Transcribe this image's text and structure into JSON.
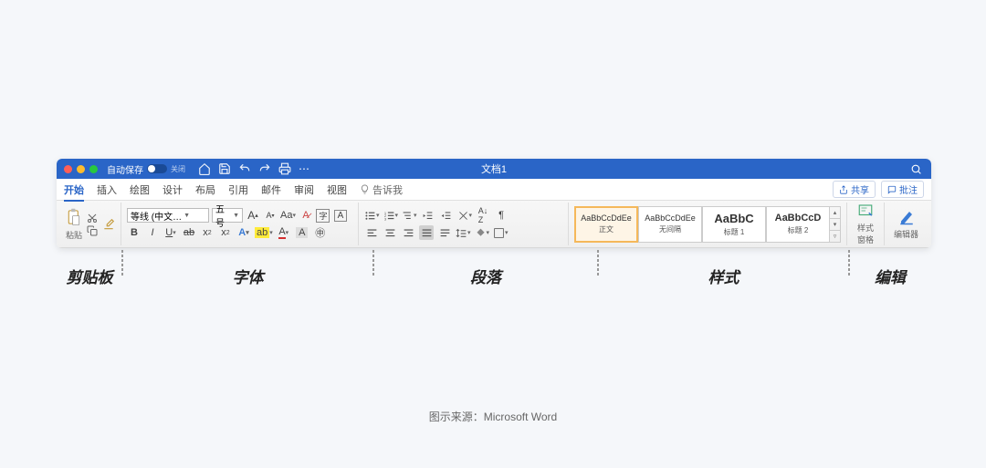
{
  "titlebar": {
    "autosave_label": "自动保存",
    "autosave_state": "关闭",
    "doc_title": "文档1"
  },
  "tabs": [
    "开始",
    "插入",
    "绘图",
    "设计",
    "布局",
    "引用",
    "邮件",
    "审阅",
    "视图"
  ],
  "tellme": "告诉我",
  "share": "共享",
  "comments": "批注",
  "clipboard": {
    "paste": "粘贴"
  },
  "font": {
    "name": "等线 (中文…",
    "size": "五号"
  },
  "styles": [
    {
      "preview": "AaBbCcDdEe",
      "name": "正文"
    },
    {
      "preview": "AaBbCcDdEe",
      "name": "无间隔"
    },
    {
      "preview": "AaBbC",
      "name": "标题 1"
    },
    {
      "preview": "AaBbCcD",
      "name": "标题 2"
    }
  ],
  "style_pane": "样式\n窗格",
  "editor": "编辑器",
  "annotations": [
    "剪贴板",
    "字体",
    "段落",
    "样式",
    "编辑"
  ],
  "caption": "图示来源：Microsoft Word"
}
